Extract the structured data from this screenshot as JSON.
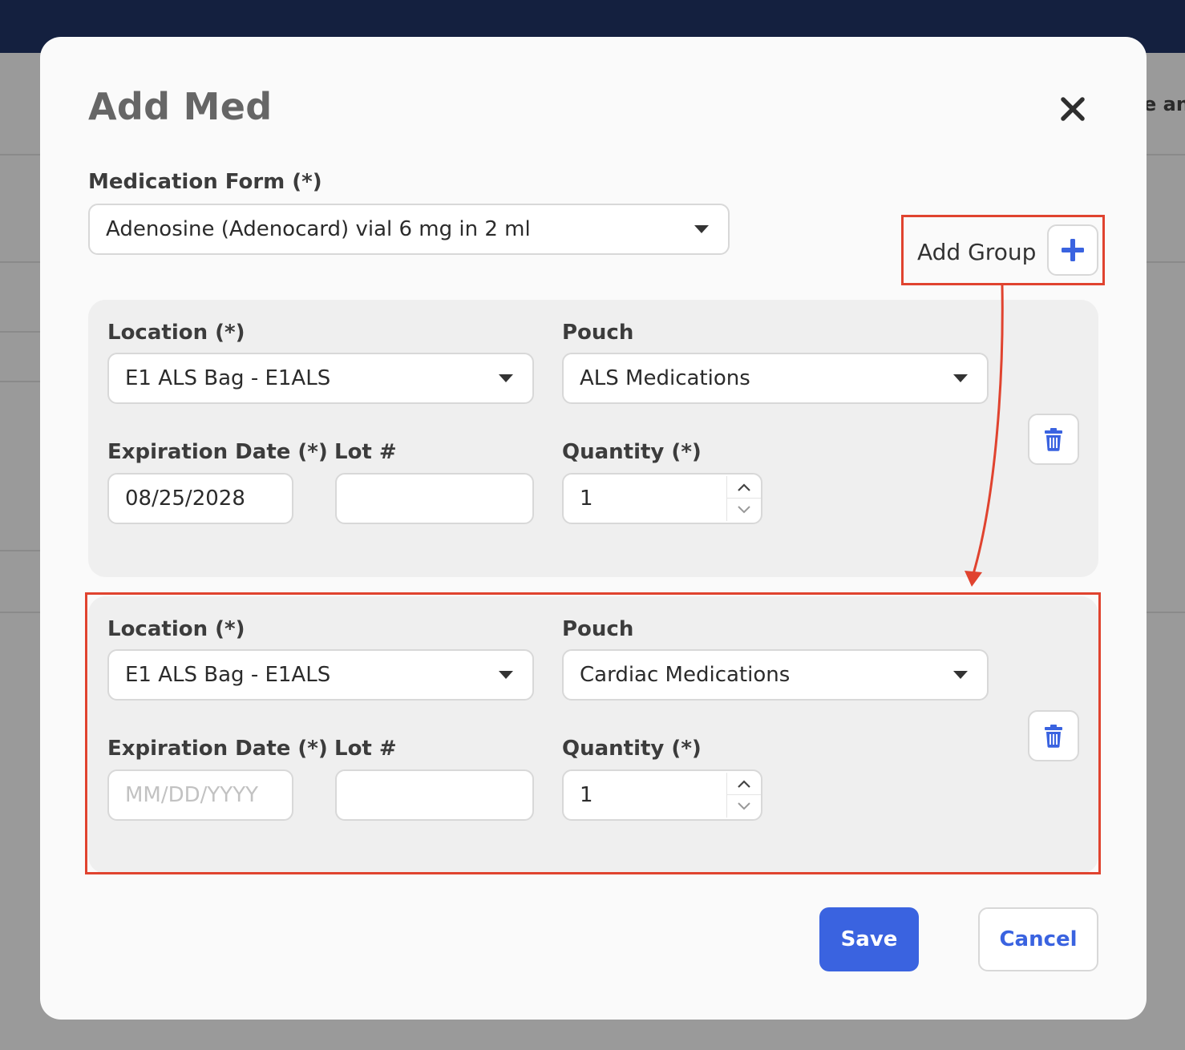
{
  "background": {
    "right_edge_text": "e an"
  },
  "modal": {
    "title": "Add Med",
    "close_icon": "close-icon",
    "medication_form": {
      "label": "Medication Form (*)",
      "value": "Adenosine (Adenocard) vial 6 mg in 2 ml"
    },
    "add_group": {
      "label": "Add Group",
      "icon": "plus-icon"
    },
    "groups": [
      {
        "location_label": "Location (*)",
        "location_value": "E1 ALS Bag - E1ALS",
        "pouch_label": "Pouch",
        "pouch_value": "ALS Medications",
        "expiration_label": "Expiration Date (*)",
        "expiration_value": "08/25/2028",
        "expiration_placeholder": "MM/DD/YYYY",
        "lot_label": "Lot #",
        "lot_value": "",
        "quantity_label": "Quantity (*)",
        "quantity_value": "1"
      },
      {
        "location_label": "Location (*)",
        "location_value": "E1 ALS Bag - E1ALS",
        "pouch_label": "Pouch",
        "pouch_value": "Cardiac Medications",
        "expiration_label": "Expiration Date (*)",
        "expiration_value": "",
        "expiration_placeholder": "MM/DD/YYYY",
        "lot_label": "Lot #",
        "lot_value": "",
        "quantity_label": "Quantity (*)",
        "quantity_value": "1"
      }
    ],
    "buttons": {
      "save": "Save",
      "cancel": "Cancel"
    }
  },
  "colors": {
    "primary": "#3a63e0",
    "annotation": "#e0432f",
    "topbar": "#14203f"
  }
}
